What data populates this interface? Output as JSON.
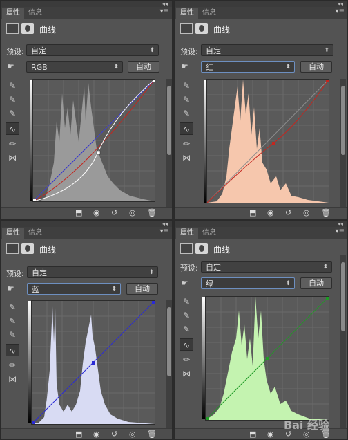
{
  "tabs": {
    "properties": "属性",
    "info": "信息"
  },
  "panel_title": "曲线",
  "preset_label": "预设:",
  "preset_value": "自定",
  "auto_label": "自动",
  "collapse_glyph": "◂◂",
  "panels": [
    {
      "id": "rgb",
      "channel": "RGB",
      "hist_color": "#9a9a9a",
      "curve_color": "#ffffff"
    },
    {
      "id": "red",
      "channel": "红",
      "hist_color": "#f6c7ad",
      "curve_color": "#c4261f"
    },
    {
      "id": "blue",
      "channel": "蓝",
      "hist_color": "#d8dbf3",
      "curve_color": "#2a2ad6"
    },
    {
      "id": "green",
      "channel": "绿",
      "hist_color": "#c4f3b0",
      "curve_color": "#1f9b26"
    }
  ],
  "watermark": "Bai 经验"
}
